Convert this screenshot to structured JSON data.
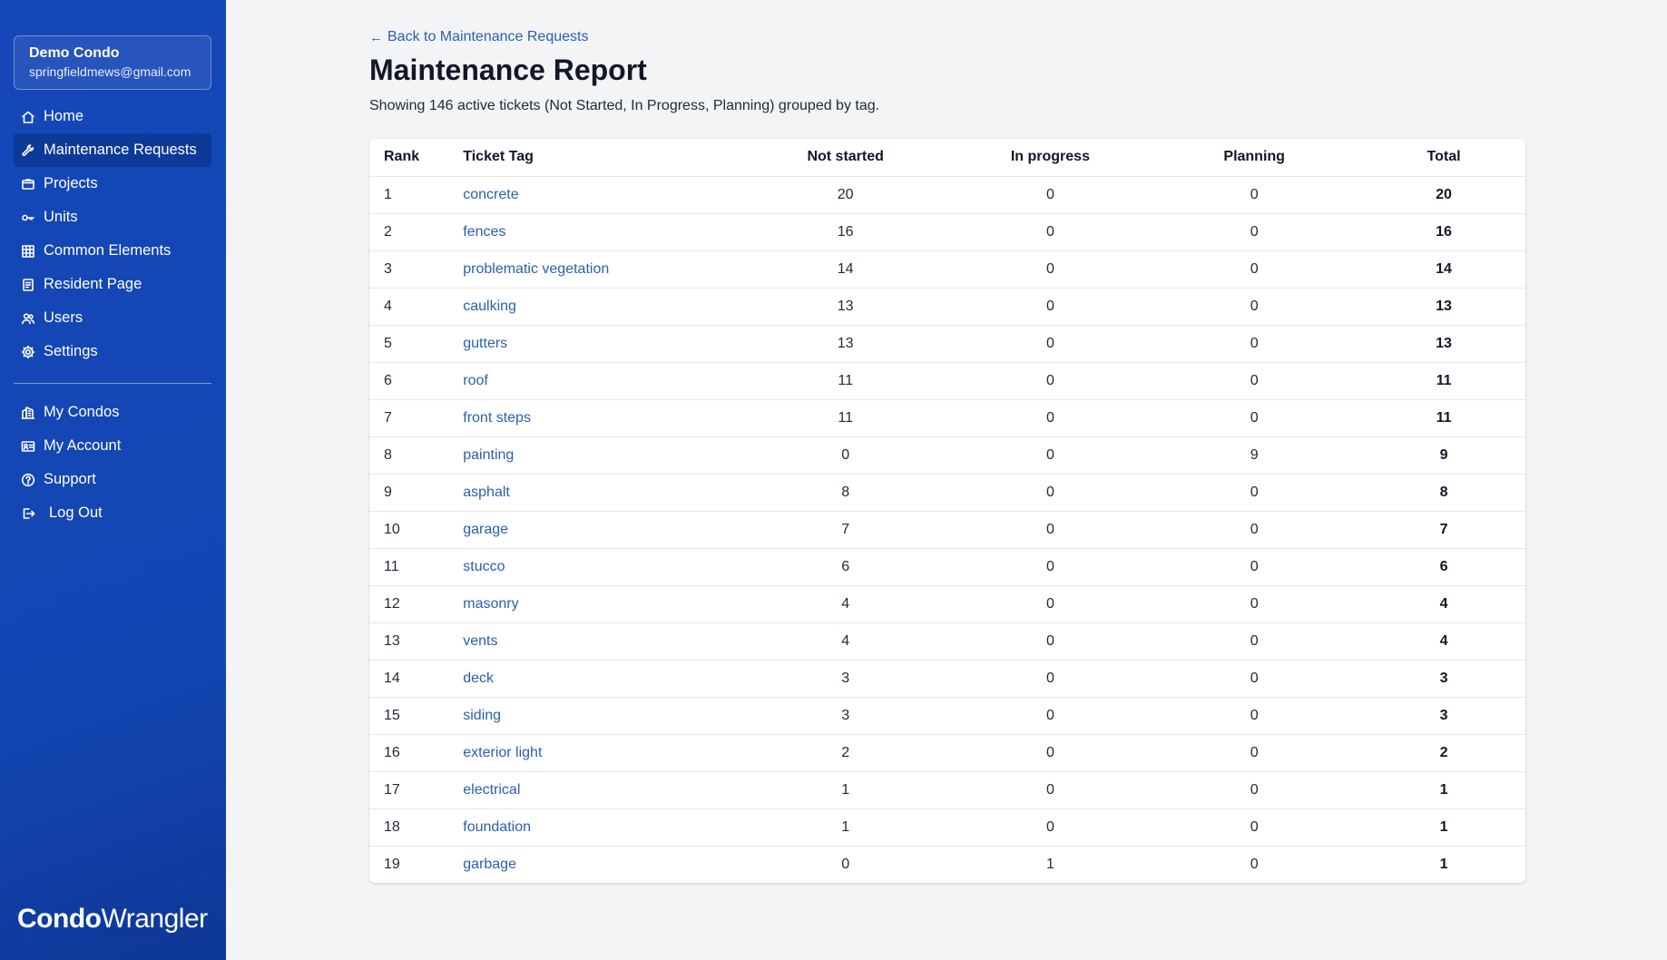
{
  "account": {
    "name": "Demo Condo",
    "email": "springfieldmews@gmail.com"
  },
  "nav": {
    "primary": [
      {
        "label": "Home",
        "icon": "home-icon"
      },
      {
        "label": "Maintenance Requests",
        "icon": "wrench-icon",
        "active": true
      },
      {
        "label": "Projects",
        "icon": "folder-icon"
      },
      {
        "label": "Units",
        "icon": "key-icon"
      },
      {
        "label": "Common Elements",
        "icon": "grid-icon"
      },
      {
        "label": "Resident Page",
        "icon": "document-icon"
      },
      {
        "label": "Users",
        "icon": "users-icon"
      },
      {
        "label": "Settings",
        "icon": "gear-icon"
      }
    ],
    "secondary": [
      {
        "label": "My Condos",
        "icon": "buildings-icon"
      },
      {
        "label": "My Account",
        "icon": "id-card-icon"
      },
      {
        "label": "Support",
        "icon": "help-icon"
      },
      {
        "label": "Log Out",
        "icon": "logout-icon"
      }
    ]
  },
  "logo": {
    "part1": "Condo",
    "part2": "Wrangler"
  },
  "main": {
    "back_link": "Back to Maintenance Requests",
    "title": "Maintenance Report",
    "subtitle": "Showing 146 active tickets (Not Started, In Progress, Planning) grouped by tag."
  },
  "table": {
    "headers": {
      "rank": "Rank",
      "tag": "Ticket Tag",
      "not_started": "Not started",
      "in_progress": "In progress",
      "planning": "Planning",
      "total": "Total"
    },
    "rows": [
      {
        "rank": "1",
        "tag": "concrete",
        "not_started": "20",
        "in_progress": "0",
        "planning": "0",
        "total": "20"
      },
      {
        "rank": "2",
        "tag": "fences",
        "not_started": "16",
        "in_progress": "0",
        "planning": "0",
        "total": "16"
      },
      {
        "rank": "3",
        "tag": "problematic vegetation",
        "not_started": "14",
        "in_progress": "0",
        "planning": "0",
        "total": "14"
      },
      {
        "rank": "4",
        "tag": "caulking",
        "not_started": "13",
        "in_progress": "0",
        "planning": "0",
        "total": "13"
      },
      {
        "rank": "5",
        "tag": "gutters",
        "not_started": "13",
        "in_progress": "0",
        "planning": "0",
        "total": "13"
      },
      {
        "rank": "6",
        "tag": "roof",
        "not_started": "11",
        "in_progress": "0",
        "planning": "0",
        "total": "11"
      },
      {
        "rank": "7",
        "tag": "front steps",
        "not_started": "11",
        "in_progress": "0",
        "planning": "0",
        "total": "11"
      },
      {
        "rank": "8",
        "tag": "painting",
        "not_started": "0",
        "in_progress": "0",
        "planning": "9",
        "total": "9"
      },
      {
        "rank": "9",
        "tag": "asphalt",
        "not_started": "8",
        "in_progress": "0",
        "planning": "0",
        "total": "8"
      },
      {
        "rank": "10",
        "tag": "garage",
        "not_started": "7",
        "in_progress": "0",
        "planning": "0",
        "total": "7"
      },
      {
        "rank": "11",
        "tag": "stucco",
        "not_started": "6",
        "in_progress": "0",
        "planning": "0",
        "total": "6"
      },
      {
        "rank": "12",
        "tag": "masonry",
        "not_started": "4",
        "in_progress": "0",
        "planning": "0",
        "total": "4"
      },
      {
        "rank": "13",
        "tag": "vents",
        "not_started": "4",
        "in_progress": "0",
        "planning": "0",
        "total": "4"
      },
      {
        "rank": "14",
        "tag": "deck",
        "not_started": "3",
        "in_progress": "0",
        "planning": "0",
        "total": "3"
      },
      {
        "rank": "15",
        "tag": "siding",
        "not_started": "3",
        "in_progress": "0",
        "planning": "0",
        "total": "3"
      },
      {
        "rank": "16",
        "tag": "exterior light",
        "not_started": "2",
        "in_progress": "0",
        "planning": "0",
        "total": "2"
      },
      {
        "rank": "17",
        "tag": "electrical",
        "not_started": "1",
        "in_progress": "0",
        "planning": "0",
        "total": "1"
      },
      {
        "rank": "18",
        "tag": "foundation",
        "not_started": "1",
        "in_progress": "0",
        "planning": "0",
        "total": "1"
      },
      {
        "rank": "19",
        "tag": "garbage",
        "not_started": "0",
        "in_progress": "1",
        "planning": "0",
        "total": "1"
      }
    ]
  },
  "colors": {
    "sidebar": "#1547b8",
    "active_nav": "#0d3a98",
    "link": "#2a5fb0",
    "background": "#f3f4f6"
  }
}
